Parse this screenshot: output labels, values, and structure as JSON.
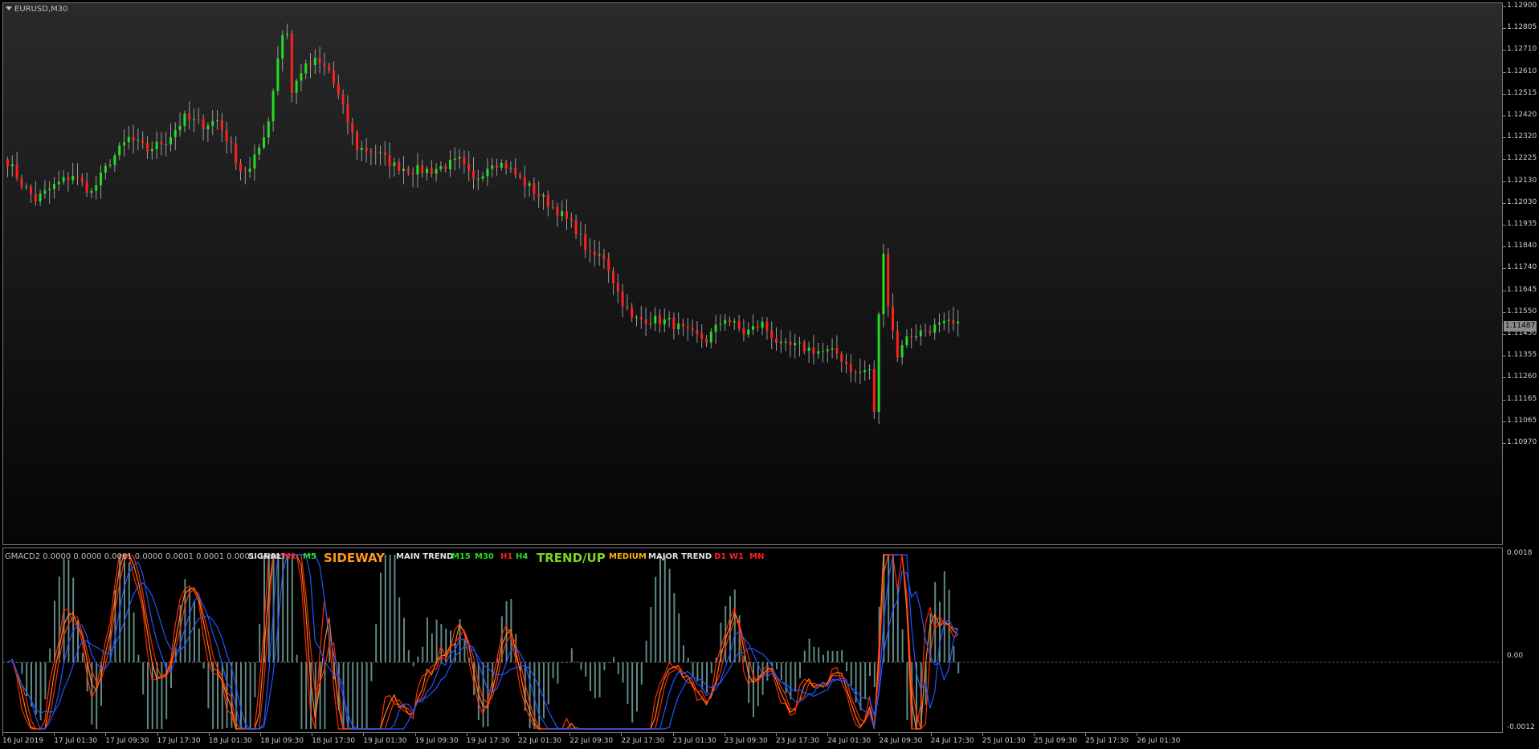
{
  "window": {
    "title": "EURUSD,M30"
  },
  "price_axis": {
    "labels": [
      "1.12900",
      "1.12805",
      "1.12710",
      "1.12610",
      "1.12515",
      "1.12420",
      "1.12320",
      "1.12225",
      "1.12130",
      "1.12030",
      "1.11935",
      "1.11840",
      "1.11740",
      "1.11645",
      "1.11550",
      "1.11450",
      "1.11355",
      "1.11260",
      "1.11165",
      "1.11065",
      "1.10970"
    ],
    "current_price": "1.11487"
  },
  "indicator_axis": {
    "labels": [
      "0.0018",
      "0.00",
      "-0.0012"
    ]
  },
  "time_axis": {
    "labels": [
      "16 Jul 2019",
      "17 Jul 01:30",
      "17 Jul 09:30",
      "17 Jul 17:30",
      "18 Jul 01:30",
      "18 Jul 09:30",
      "18 Jul 17:30",
      "19 Jul 01:30",
      "19 Jul 09:30",
      "19 Jul 17:30",
      "22 Jul 01:30",
      "22 Jul 09:30",
      "22 Jul 17:30",
      "23 Jul 01:30",
      "23 Jul 09:30",
      "23 Jul 17:30",
      "24 Jul 01:30",
      "24 Jul 09:30",
      "24 Jul 17:30",
      "25 Jul 01:30",
      "25 Jul 09:30",
      "25 Jul 17:30",
      "26 Jul 01:30"
    ]
  },
  "indicator": {
    "label": "GMACD2 0.0000 0.0000 0.0001 0.0000 0.0001 0.0001 0.0001 0.0001",
    "panel": [
      {
        "text": "SIGNAL",
        "color": "#e0e0e0"
      },
      {
        "text": "M1",
        "color": "#ff2020"
      },
      {
        "text": "M5",
        "color": "#22dd22"
      },
      {
        "text": "SIDEWAY",
        "color": "#ff9a1a"
      },
      {
        "text": "MAIN TREND",
        "color": "#e0e0e0"
      },
      {
        "text": "M15",
        "color": "#22dd22"
      },
      {
        "text": "M30",
        "color": "#22dd22"
      },
      {
        "text": "H1",
        "color": "#ff2020"
      },
      {
        "text": "H4",
        "color": "#22dd22"
      },
      {
        "text": "TREND/UP",
        "color": "#7ed321"
      },
      {
        "text": "MEDIUM",
        "color": "#ffb000"
      },
      {
        "text": "MAJOR TREND",
        "color": "#e0e0e0"
      },
      {
        "text": "D1",
        "color": "#ff2020"
      },
      {
        "text": "W1",
        "color": "#ff2020"
      },
      {
        "text": "MN",
        "color": "#ff2020"
      }
    ]
  },
  "colors": {
    "bull_candle": "#22dd22",
    "bear_candle": "#ff2020",
    "wick": "#9a9a9a",
    "histogram": "#5f8a85",
    "line_blue": "#2255ff",
    "line_orange": "#ff7f1a",
    "line_red": "#ff2a00",
    "zero_line": "#777777"
  },
  "chart_data": {
    "type": "candlestick",
    "symbol": "EURUSD",
    "timeframe": "M30",
    "ylim": [
      1.1097,
      1.129
    ],
    "close_path": [
      [
        0,
        1.1222
      ],
      [
        3,
        1.1212
      ],
      [
        6,
        1.1205
      ],
      [
        10,
        1.1211
      ],
      [
        14,
        1.1216
      ],
      [
        18,
        1.1208
      ],
      [
        22,
        1.1222
      ],
      [
        26,
        1.1232
      ],
      [
        30,
        1.1227
      ],
      [
        34,
        1.1231
      ],
      [
        38,
        1.1241
      ],
      [
        42,
        1.1238
      ],
      [
        45,
        1.124
      ],
      [
        48,
        1.1228
      ],
      [
        50,
        1.1218
      ],
      [
        52,
        1.1218
      ],
      [
        54,
        1.1228
      ],
      [
        56,
        1.124
      ],
      [
        58,
        1.1268
      ],
      [
        59,
        1.1278
      ],
      [
        60,
        1.1279
      ],
      [
        61,
        1.1252
      ],
      [
        63,
        1.1262
      ],
      [
        66,
        1.1266
      ],
      [
        69,
        1.1262
      ],
      [
        72,
        1.1245
      ],
      [
        75,
        1.1228
      ],
      [
        79,
        1.1226
      ],
      [
        83,
        1.122
      ],
      [
        87,
        1.1218
      ],
      [
        91,
        1.1218
      ],
      [
        94,
        1.122
      ],
      [
        97,
        1.1222
      ],
      [
        100,
        1.1213
      ],
      [
        104,
        1.1222
      ],
      [
        107,
        1.122
      ],
      [
        110,
        1.1214
      ],
      [
        114,
        1.1207
      ],
      [
        118,
        1.12
      ],
      [
        122,
        1.1192
      ],
      [
        125,
        1.118
      ],
      [
        128,
        1.118
      ],
      [
        131,
        1.1164
      ],
      [
        134,
        1.1152
      ],
      [
        138,
        1.1152
      ],
      [
        142,
        1.1151
      ],
      [
        146,
        1.1146
      ],
      [
        150,
        1.1143
      ],
      [
        154,
        1.1153
      ],
      [
        158,
        1.1146
      ],
      [
        162,
        1.115
      ],
      [
        166,
        1.114
      ],
      [
        170,
        1.114
      ],
      [
        174,
        1.1138
      ],
      [
        178,
        1.1137
      ],
      [
        182,
        1.1128
      ],
      [
        185,
        1.113
      ],
      [
        186,
        1.111
      ],
      [
        187,
        1.1155
      ],
      [
        188,
        1.118
      ],
      [
        189,
        1.116
      ],
      [
        190,
        1.1148
      ],
      [
        191,
        1.1135
      ],
      [
        192,
        1.1142
      ],
      [
        194,
        1.1145
      ],
      [
        198,
        1.1148
      ],
      [
        202,
        1.115
      ],
      [
        204,
        1.1149
      ]
    ]
  }
}
